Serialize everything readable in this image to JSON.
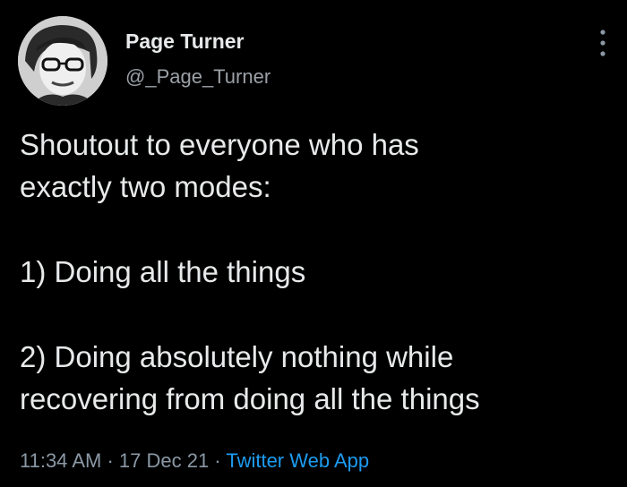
{
  "user": {
    "display_name": "Page Turner",
    "handle": "@_Page_Turner"
  },
  "tweet": {
    "lines": [
      "Shoutout to everyone who has",
      "exactly two modes:",
      "1) Doing all the things",
      "2) Doing absolutely nothing while",
      "recovering from doing all the things"
    ]
  },
  "meta": {
    "time": "11:34 AM",
    "separator": " · ",
    "date": "17 Dec 21",
    "source": "Twitter Web App"
  },
  "icons": {
    "more": "more-options-icon",
    "avatar": "avatar"
  },
  "colors": {
    "background": "#000000",
    "text": "#e7e9ea",
    "secondary": "#8b98a5",
    "link": "#1d9bf0"
  }
}
